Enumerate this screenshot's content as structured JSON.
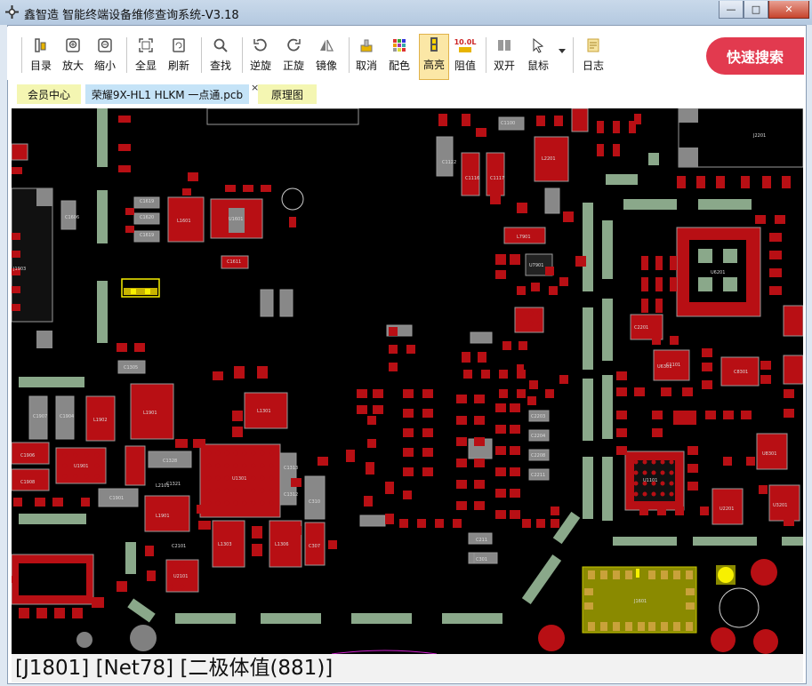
{
  "window": {
    "title": "鑫智造 智能终端设备维修查询系统-V3.18",
    "minimize": "—",
    "maximize": "□",
    "close": "✕"
  },
  "toolbar": {
    "items": [
      {
        "label": "目录",
        "icon": "catalog-icon"
      },
      {
        "label": "放大",
        "icon": "zoom-in-icon"
      },
      {
        "label": "缩小",
        "icon": "zoom-out-icon"
      },
      {
        "label": "全显",
        "icon": "fit-all-icon"
      },
      {
        "label": "刷新",
        "icon": "refresh-icon"
      },
      {
        "label": "查找",
        "icon": "search-icon"
      },
      {
        "label": "逆旋",
        "icon": "rotate-ccw-icon"
      },
      {
        "label": "正旋",
        "icon": "rotate-cw-icon"
      },
      {
        "label": "镜像",
        "icon": "mirror-icon"
      },
      {
        "label": "取消",
        "icon": "cancel-icon"
      },
      {
        "label": "配色",
        "icon": "palette-icon"
      },
      {
        "label": "高亮",
        "icon": "highlight-icon"
      },
      {
        "label": "阻值",
        "icon": "resistance-icon",
        "icon_text": "10.0L"
      },
      {
        "label": "双开",
        "icon": "dual-open-icon"
      },
      {
        "label": "鼠标",
        "icon": "mouse-cursor-icon"
      },
      {
        "label": "日志",
        "icon": "log-icon"
      }
    ],
    "active": "高亮",
    "quick_search": "快速搜索"
  },
  "tabs": [
    {
      "label": "会员中心"
    },
    {
      "label": "荣耀9X-HL1 HLKM 一点通.pcb",
      "close": "×"
    },
    {
      "label": "原理图"
    }
  ],
  "pcb": {
    "labels": [
      "J2201",
      "L2201",
      "C1122",
      "C1116",
      "C1117",
      "L7901",
      "U7901",
      "U6201",
      "U6301",
      "C1606",
      "L1601",
      "U1601",
      "C1619",
      "C1620",
      "C1619",
      "C1611",
      "J1903",
      "C1305",
      "L1901",
      "L1902",
      "C1907",
      "C1904",
      "L1301",
      "C1906",
      "U1901",
      "C1908",
      "L1901",
      "C1901",
      "C1328",
      "C1321",
      "U1301",
      "C1313",
      "C1312",
      "C310",
      "L2101",
      "C2101",
      "L1303",
      "L1306",
      "U2101",
      "C307",
      "C2203",
      "C2204",
      "C2208",
      "C2211",
      "C211",
      "C301",
      "J1601",
      "U1101",
      "C1100",
      "C8301",
      "U8301",
      "C2201",
      "U3201",
      "U2201",
      "C1101"
    ]
  },
  "status": {
    "text": "[J1801] [Net78] [二极体值(881)]"
  },
  "colors": {
    "board": "#000000",
    "pad_red": "#b80f14",
    "component_gray": "#808080",
    "silk_green": "#8aa88a",
    "highlight_yellow": "#f7f000",
    "quick_search_bg": "#e23a4f"
  }
}
